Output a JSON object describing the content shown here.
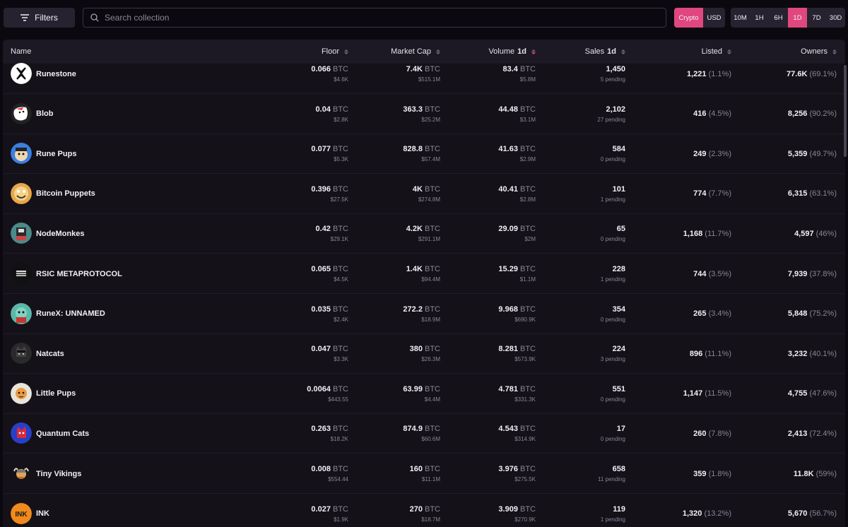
{
  "toolbar": {
    "filters_label": "Filters",
    "search_placeholder": "Search collection",
    "currency_options": [
      "Crypto",
      "USD"
    ],
    "currency_selected": "Crypto",
    "time_options": [
      "10M",
      "1H",
      "6H",
      "1D",
      "7D",
      "30D"
    ],
    "time_selected": "1D",
    "accent_color": "#e0477f"
  },
  "table": {
    "headers": {
      "name": "Name",
      "floor": "Floor",
      "market_cap": "Market Cap",
      "volume": "Volume",
      "volume_period": "1d",
      "sales": "Sales",
      "sales_period": "1d",
      "listed": "Listed",
      "owners": "Owners"
    },
    "rows": [
      {
        "name": "Runestone",
        "icon": "runestone-icon",
        "floor": "0.066",
        "floor_unit": "BTC",
        "floor_usd": "$4.6K",
        "mcap": "7.4K",
        "mcap_unit": "BTC",
        "mcap_usd": "$515.1M",
        "volume": "83.4",
        "volume_unit": "BTC",
        "volume_usd": "$5.8M",
        "sales": "1,450",
        "pending": "5 pending",
        "listed": "1,221",
        "listed_pct": "(1.1%)",
        "owners": "77.6K",
        "owners_pct": "(69.1%)"
      },
      {
        "name": "Blob",
        "icon": "blob-icon",
        "floor": "0.04",
        "floor_unit": "BTC",
        "floor_usd": "$2.8K",
        "mcap": "363.3",
        "mcap_unit": "BTC",
        "mcap_usd": "$25.2M",
        "volume": "44.48",
        "volume_unit": "BTC",
        "volume_usd": "$3.1M",
        "sales": "2,102",
        "pending": "27 pending",
        "listed": "416",
        "listed_pct": "(4.5%)",
        "owners": "8,256",
        "owners_pct": "(90.2%)"
      },
      {
        "name": "Rune Pups",
        "icon": "rune-pups-icon",
        "floor": "0.077",
        "floor_unit": "BTC",
        "floor_usd": "$5.3K",
        "mcap": "828.8",
        "mcap_unit": "BTC",
        "mcap_usd": "$57.4M",
        "volume": "41.63",
        "volume_unit": "BTC",
        "volume_usd": "$2.9M",
        "sales": "584",
        "pending": "0 pending",
        "listed": "249",
        "listed_pct": "(2.3%)",
        "owners": "5,359",
        "owners_pct": "(49.7%)"
      },
      {
        "name": "Bitcoin Puppets",
        "icon": "bitcoin-puppets-icon",
        "floor": "0.396",
        "floor_unit": "BTC",
        "floor_usd": "$27.5K",
        "mcap": "4K",
        "mcap_unit": "BTC",
        "mcap_usd": "$274.8M",
        "volume": "40.41",
        "volume_unit": "BTC",
        "volume_usd": "$2.8M",
        "sales": "101",
        "pending": "1 pending",
        "listed": "774",
        "listed_pct": "(7.7%)",
        "owners": "6,315",
        "owners_pct": "(63.1%)"
      },
      {
        "name": "NodeMonkes",
        "icon": "nodemonkes-icon",
        "floor": "0.42",
        "floor_unit": "BTC",
        "floor_usd": "$29.1K",
        "mcap": "4.2K",
        "mcap_unit": "BTC",
        "mcap_usd": "$291.1M",
        "volume": "29.09",
        "volume_unit": "BTC",
        "volume_usd": "$2M",
        "sales": "65",
        "pending": "0 pending",
        "listed": "1,168",
        "listed_pct": "(11.7%)",
        "owners": "4,597",
        "owners_pct": "(46%)"
      },
      {
        "name": "RSIC METAPROTOCOL",
        "icon": "rsic-icon",
        "floor": "0.065",
        "floor_unit": "BTC",
        "floor_usd": "$4.5K",
        "mcap": "1.4K",
        "mcap_unit": "BTC",
        "mcap_usd": "$94.4M",
        "volume": "15.29",
        "volume_unit": "BTC",
        "volume_usd": "$1.1M",
        "sales": "228",
        "pending": "1 pending",
        "listed": "744",
        "listed_pct": "(3.5%)",
        "owners": "7,939",
        "owners_pct": "(37.8%)"
      },
      {
        "name": "RuneX: UNNAMED",
        "icon": "runex-icon",
        "floor": "0.035",
        "floor_unit": "BTC",
        "floor_usd": "$2.4K",
        "mcap": "272.2",
        "mcap_unit": "BTC",
        "mcap_usd": "$18.9M",
        "volume": "9.968",
        "volume_unit": "BTC",
        "volume_usd": "$690.9K",
        "sales": "354",
        "pending": "0 pending",
        "listed": "265",
        "listed_pct": "(3.4%)",
        "owners": "5,848",
        "owners_pct": "(75.2%)"
      },
      {
        "name": "Natcats",
        "icon": "natcats-icon",
        "floor": "0.047",
        "floor_unit": "BTC",
        "floor_usd": "$3.3K",
        "mcap": "380",
        "mcap_unit": "BTC",
        "mcap_usd": "$26.3M",
        "volume": "8.281",
        "volume_unit": "BTC",
        "volume_usd": "$573.9K",
        "sales": "224",
        "pending": "3 pending",
        "listed": "896",
        "listed_pct": "(11.1%)",
        "owners": "3,232",
        "owners_pct": "(40.1%)"
      },
      {
        "name": "Little Pups",
        "icon": "little-pups-icon",
        "floor": "0.0064",
        "floor_unit": "BTC",
        "floor_usd": "$443.55",
        "mcap": "63.99",
        "mcap_unit": "BTC",
        "mcap_usd": "$4.4M",
        "volume": "4.781",
        "volume_unit": "BTC",
        "volume_usd": "$331.3K",
        "sales": "551",
        "pending": "0 pending",
        "listed": "1,147",
        "listed_pct": "(11.5%)",
        "owners": "4,755",
        "owners_pct": "(47.6%)"
      },
      {
        "name": "Quantum Cats",
        "icon": "quantum-cats-icon",
        "floor": "0.263",
        "floor_unit": "BTC",
        "floor_usd": "$18.2K",
        "mcap": "874.9",
        "mcap_unit": "BTC",
        "mcap_usd": "$60.6M",
        "volume": "4.543",
        "volume_unit": "BTC",
        "volume_usd": "$314.9K",
        "sales": "17",
        "pending": "0 pending",
        "listed": "260",
        "listed_pct": "(7.8%)",
        "owners": "2,413",
        "owners_pct": "(72.4%)"
      },
      {
        "name": "Tiny Vikings",
        "icon": "tiny-vikings-icon",
        "floor": "0.008",
        "floor_unit": "BTC",
        "floor_usd": "$554.44",
        "mcap": "160",
        "mcap_unit": "BTC",
        "mcap_usd": "$11.1M",
        "volume": "3.976",
        "volume_unit": "BTC",
        "volume_usd": "$275.5K",
        "sales": "658",
        "pending": "11 pending",
        "listed": "359",
        "listed_pct": "(1.8%)",
        "owners": "11.8K",
        "owners_pct": "(59%)"
      },
      {
        "name": "INK",
        "icon": "ink-icon",
        "icon_text": "INK",
        "floor": "0.027",
        "floor_unit": "BTC",
        "floor_usd": "$1.9K",
        "mcap": "270",
        "mcap_unit": "BTC",
        "mcap_usd": "$18.7M",
        "volume": "3.909",
        "volume_unit": "BTC",
        "volume_usd": "$270.9K",
        "sales": "119",
        "pending": "1 pending",
        "listed": "1,320",
        "listed_pct": "(13.2%)",
        "owners": "5,670",
        "owners_pct": "(56.7%)"
      }
    ]
  }
}
